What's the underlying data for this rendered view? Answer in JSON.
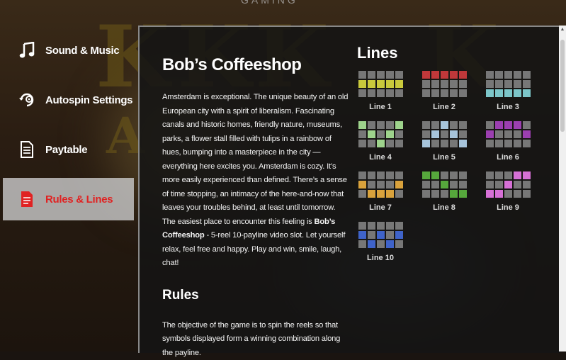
{
  "header": {
    "brand": "GAMING"
  },
  "sidebar": {
    "items": [
      {
        "label": "Sound & Music",
        "icon": "music-note-icon"
      },
      {
        "label": "Autospin Settings",
        "icon": "autospin-icon"
      },
      {
        "label": "Paytable",
        "icon": "paytable-icon"
      },
      {
        "label": "Rules & Lines",
        "icon": "rules-document-icon",
        "active": true
      }
    ]
  },
  "content": {
    "title": "Bob’s Coffeeshop",
    "intro": "Amsterdam is exceptional. The unique beauty of an old European city with a spirit of liberalism. Fascinating canals and historic homes, friendly nature, museums, parks, a flower stall filled with tulips in a rainbow of hues, bumping into a masterpiece in the city — everything here excites you. Amsterdam is cozy. It’s more easily experienced than defined. There’s a sense of time stopping, an intimacy of the here-and-now that leaves your troubles behind, at least until tomorrow. The easiest place to encounter this feeling is ",
    "intro_bold": "Bob’s Coffeeshop",
    "intro_end": " - 5-reel 10-payline video slot. Let yourself relax, feel free and happy. Play and win, smile, laugh, chat!",
    "rules_heading": "Rules",
    "rules_text": "The objective of the game is to spin the reels so that symbols displayed form a winning combination along the payline."
  },
  "lines": {
    "title": "Lines",
    "items": [
      {
        "label": "Line 1",
        "color": "#c9c93c",
        "rows": [
          1,
          1,
          1,
          1,
          1
        ]
      },
      {
        "label": "Line 2",
        "color": "#c0383a",
        "rows": [
          0,
          0,
          0,
          0,
          0
        ]
      },
      {
        "label": "Line 3",
        "color": "#7cc6c9",
        "rows": [
          2,
          2,
          2,
          2,
          2
        ]
      },
      {
        "label": "Line 4",
        "color": "#9ed38c",
        "rows": [
          0,
          1,
          2,
          1,
          0
        ]
      },
      {
        "label": "Line 5",
        "color": "#a7c4db",
        "rows": [
          2,
          1,
          0,
          1,
          2
        ]
      },
      {
        "label": "Line 6",
        "color": "#9b3fb0",
        "rows": [
          1,
          0,
          0,
          0,
          1
        ]
      },
      {
        "label": "Line 7",
        "color": "#d9a23c",
        "rows": [
          1,
          2,
          2,
          2,
          1
        ]
      },
      {
        "label": "Line 8",
        "color": "#56a83c",
        "rows": [
          0,
          0,
          1,
          2,
          2
        ]
      },
      {
        "label": "Line 9",
        "color": "#d670d6",
        "rows": [
          2,
          2,
          1,
          0,
          0
        ]
      },
      {
        "label": "Line 10",
        "color": "#3f63c9",
        "rows": [
          1,
          2,
          1,
          2,
          1
        ]
      }
    ]
  },
  "colors": {
    "active_label": "#e02222",
    "active_bg": "#c8c8c8",
    "panel_bg": "#141414"
  }
}
